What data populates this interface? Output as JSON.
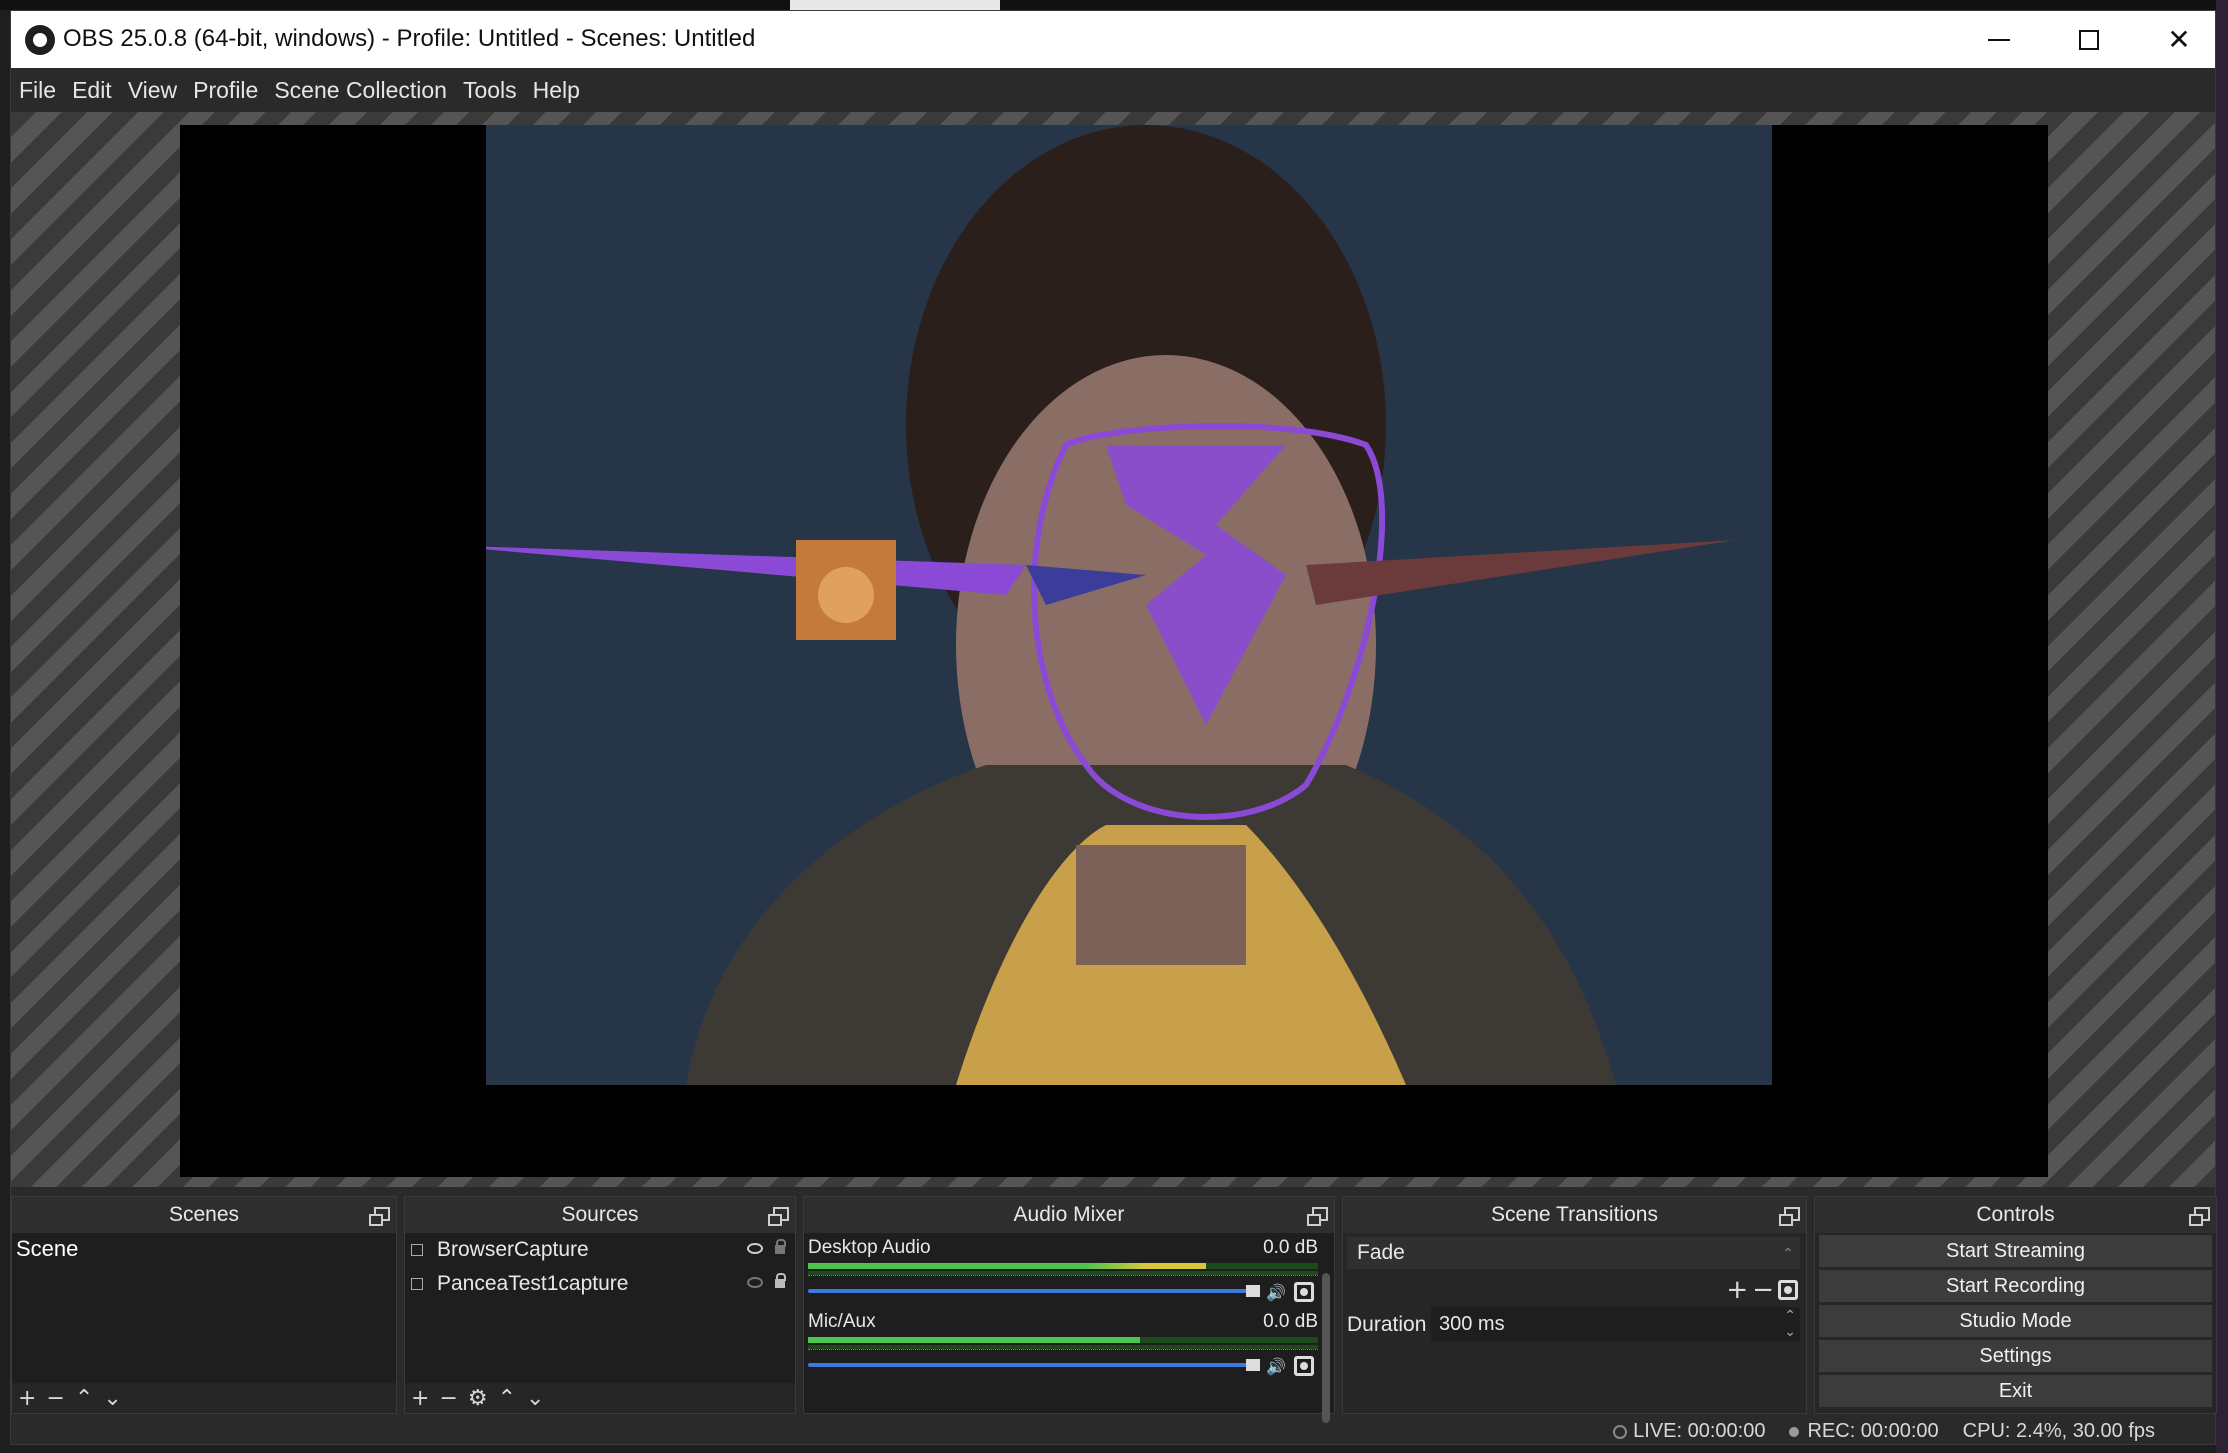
{
  "window": {
    "title": "OBS 25.0.8 (64-bit, windows) - Profile: Untitled - Scenes: Untitled",
    "minimize_icon": "minimize-icon",
    "maximize_icon": "maximize-icon",
    "close_icon": "close-icon",
    "close_glyph": "✕"
  },
  "menu": {
    "items": [
      "File",
      "Edit",
      "View",
      "Profile",
      "Scene Collection",
      "Tools",
      "Help"
    ]
  },
  "preview": {
    "overlay_color": "#8b4ad6",
    "background_color": "#263547"
  },
  "docks": {
    "scenes": {
      "title": "Scenes",
      "items": [
        "Scene"
      ],
      "toolbar": [
        "+",
        "−",
        "⌃",
        "⌄"
      ]
    },
    "sources": {
      "title": "Sources",
      "items": [
        {
          "label": "BrowserCapture",
          "visible": true,
          "locked": false
        },
        {
          "label": "PanceaTest1capture",
          "visible": false,
          "locked": true
        }
      ],
      "toolbar": [
        "+",
        "−",
        "⚙",
        "⌃",
        "⌄"
      ]
    },
    "audio_mixer": {
      "title": "Audio Mixer",
      "channels": [
        {
          "name": "Desktop Audio",
          "db": "0.0 dB",
          "level": 0.78
        },
        {
          "name": "Mic/Aux",
          "db": "0.0 dB",
          "level": 0.65
        }
      ]
    },
    "scene_transitions": {
      "title": "Scene Transitions",
      "selected": "Fade",
      "tools": [
        "+",
        "−"
      ],
      "duration_label": "Duration",
      "duration_value": "300 ms"
    },
    "controls": {
      "title": "Controls",
      "buttons": [
        "Start Streaming",
        "Start Recording",
        "Studio Mode",
        "Settings",
        "Exit"
      ]
    }
  },
  "status": {
    "live": "LIVE: 00:00:00",
    "rec": "REC: 00:00:00",
    "cpu": "CPU: 2.4%, 30.00 fps"
  }
}
